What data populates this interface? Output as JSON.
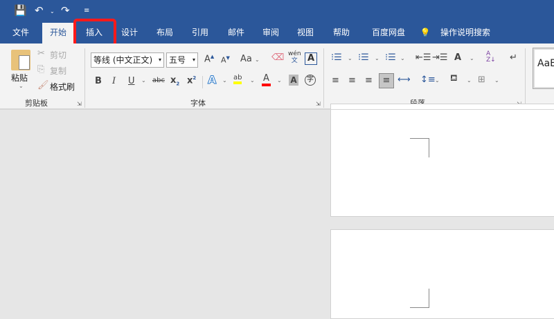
{
  "qat": {
    "icons": [
      "save-icon",
      "undo-icon",
      "redo-icon",
      "customize-icon"
    ]
  },
  "tabs": [
    {
      "label": "文件"
    },
    {
      "label": "开始"
    },
    {
      "label": "插入"
    },
    {
      "label": "设计"
    },
    {
      "label": "布局"
    },
    {
      "label": "引用"
    },
    {
      "label": "邮件"
    },
    {
      "label": "审阅"
    },
    {
      "label": "视图"
    },
    {
      "label": "帮助"
    },
    {
      "label": "百度网盘"
    },
    {
      "label": "操作说明搜索"
    }
  ],
  "active_tab": "开始",
  "highlighted_tab": "插入",
  "clipboard": {
    "paste": "粘贴",
    "cut": "剪切",
    "copy": "复制",
    "format_painter": "格式刷",
    "group": "剪贴板"
  },
  "font": {
    "name": "等线 (中文正文)",
    "size": "五号",
    "change_case": "Aa",
    "phonetic_top": "wén",
    "phonetic_bottom": "文",
    "enclose": "字",
    "group": "字体"
  },
  "paragraph": {
    "group": "段落"
  },
  "styles": {
    "preview": "AaB"
  },
  "colors": {
    "brand": "#2b579a",
    "highlight": "#ffff00",
    "font_color": "#ff0000",
    "callout": "#ff1a1a"
  }
}
